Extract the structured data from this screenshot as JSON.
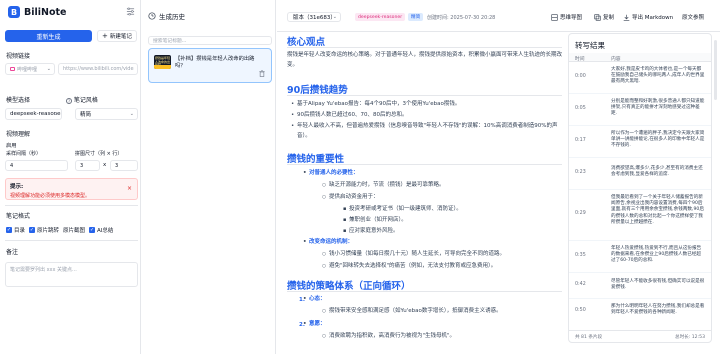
{
  "app": {
    "name": "BiliNote",
    "logo_letter": "B"
  },
  "sidebar": {
    "generate_label": "重新生成",
    "new_note_label": "新建笔记",
    "video_link_label": "视频链接",
    "platform_select": "哔哩哔哩",
    "url_placeholder": "https://www.bilibili.com/vide",
    "model_label": "模型选择",
    "style_label": "笔记风格",
    "model_value": "deepseek-reasone",
    "style_value": "精简",
    "video_understanding_label": "视频理解",
    "enable_label": "启用",
    "sample_interval_label": "采样间隔（秒）",
    "sample_interval_value": "4",
    "grid_size_label": "拼图尺寸（列 × 行）",
    "grid_cols": "3",
    "grid_x": "x",
    "grid_rows": "3",
    "tip_title": "提示:",
    "tip_text": "视频理解功能必须使用多模态模型。",
    "note_format_label": "笔记格式",
    "format_options": [
      "目录",
      "原片跳转",
      "原片截图",
      "AI总结"
    ],
    "remark_label": "备注",
    "remark_placeholder": "笔记需要罗列出 xxx 关键点..."
  },
  "history": {
    "title": "生成历史",
    "search_placeholder": "搜索笔记标题...",
    "items": [
      {
        "title": "【补档】攒钱是年轻人改命的出路吗？",
        "thumb_text": "攒钱是年轻人改命的出路吗"
      }
    ]
  },
  "header": {
    "version": "版本（31e683）",
    "model_badge": "deepseek-reasoner",
    "style_badge": "精简",
    "created": "创建时间: 2025-07-30 20:28",
    "mindmap": "思维导图",
    "copy": "复制",
    "export": "导出 Markdown",
    "source": "原文参照"
  },
  "note": {
    "h_core": "核心观点",
    "p_core": "攒钱是年轻人改变命运的核心策略。对于普通年轻人，攒钱提供原始资本，积累微小赢面可带来人生轨迹的长期改变。",
    "h_trend": "90后攒钱趋势",
    "trend_items": [
      "基于Alipay Yu'ebao报告：每4个90后中，3个使用Yu'ebao攒钱。",
      "90后攒钱人数已超过60、70、80后的总和。",
      "年轻人最收入不高，但普遍热爱攒钱（信息嗅音导致\"年轻人不存钱\"的误解：10%高调消费者制造90%的声音）。"
    ],
    "h_importance": "攒钱的重要性",
    "imp_sub1": "对普通人的必要性：",
    "imp_sub1_items": [
      "缺乏开源能力时，节流（攒钱）是最可靠策略。",
      "提供启动资金用于："
    ],
    "imp_sub1_nested": [
      "投资考研或考证书（如一级建筑师、消防证）。",
      "兼职创业（如开网店）。",
      "应对家庭意外风险。"
    ],
    "imp_sub2": "改变命运的机制：",
    "imp_sub2_items": [
      "钱小习惯储量（如每日攒几十元）随人生延长，可导向完全不同的道路。",
      "避免\"回味转失去选择权\"的痛苦（例如，无法支付教育或应急费用）。"
    ],
    "h_strategy": "攒钱的策略体系（正向循环）",
    "strategy": [
      {
        "num": "1.",
        "title": "心态：",
        "text": "攒钱带来安全感和满足感（如Yu'ebao数字增长），抵御消费主义诱惑。"
      },
      {
        "num": "2.",
        "title": "意愿：",
        "text": "消费欲聘为指积欲，高消费行为被视为\"生钱母机\"。"
      }
    ]
  },
  "transcript": {
    "title": "转写结果",
    "col_time": "时间",
    "col_content": "内容",
    "rows": [
      {
        "time": "0:00",
        "text": "大家好,我是皮卡鸡的大体者也,是一个每天都在鼓励我自己储头的哪吒两人,成年人的世界里最有两大黑暗."
      },
      {
        "time": "0:05",
        "text": "分别是能而整和好刺激,很多普通人都只知道能拼架,只有真正的能拼才深刻地感受过这种差距."
      },
      {
        "time": "0:17",
        "text": "所以作为一个遭遍的胖子,我决定今天跟大家简单讲一讲能拼能论,在很多人的印象中年轻人是不存钱的."
      },
      {
        "time": "0:23",
        "text": "消费欲望高,爆多少,花多少,甚至有的消费主还会考虑到我,显爱各样的追席."
      },
      {
        "time": "0:29",
        "text": "但我最近看到了一个关于年轻人储蓄报告的新闻原告,余视业出我内容设置消费,每四个90后里面,就有三个用用余余宝攒钱,余钱两数,90后的攒钱人数的总和对比起一个你这攒样使了我所攒量以上攒越攒在."
      },
      {
        "time": "0:35",
        "text": "年轻人热爱攒钱,热爱到不行,而且从这份报告的数据来看,在余攒业上90后攒钱人数已经超过了60-70后的总和."
      },
      {
        "time": "0:42",
        "text": "尽管年轻人不能收多很有钱,但确实可以说是很爱攒钱."
      },
      {
        "time": "0:50",
        "text": "那为什么明明年轻人在努力攒钱,我们却总是看到年轻人不爱攒钱的各种新闻呢."
      }
    ],
    "footer_left": "共 81 条片段",
    "footer_right": "总时长: 12:53"
  },
  "colors": {
    "accent": "#2563eb",
    "danger": "#dc2626",
    "pink": "#db2777"
  }
}
